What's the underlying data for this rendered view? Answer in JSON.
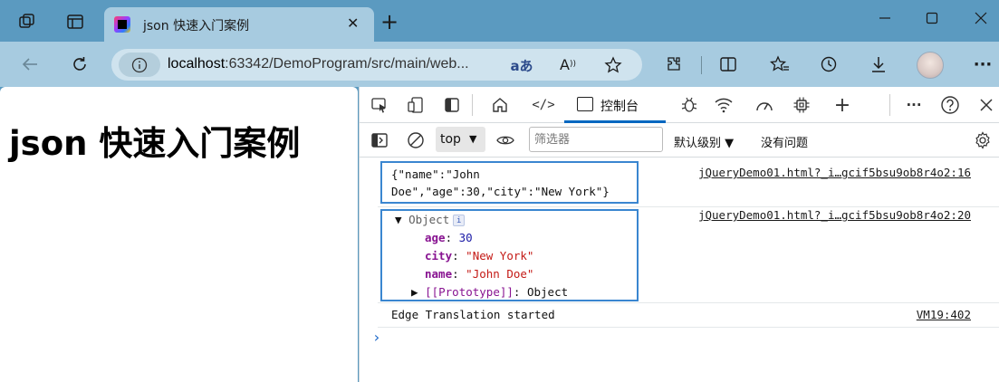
{
  "browser": {
    "tab_title": "json 快速入门案例",
    "tab_close": "✕",
    "new_tab": "+",
    "url_host": "localhost",
    "url_rest": ":63342/DemoProgram/src/main/web...",
    "colors": {
      "frame": "#5b9ac0",
      "toolbar": "#a7cbe0",
      "omnibox": "#cfe3ee"
    },
    "icons": [
      "workspaces-icon",
      "tab-actions-icon",
      "back-icon",
      "refresh-icon",
      "info-icon",
      "translate-icon",
      "read-aloud-icon",
      "favorite-star-icon",
      "extensions-icon",
      "split-screen-icon",
      "favorites-icon",
      "history-icon",
      "downloads-icon",
      "profile-avatar",
      "more-icon"
    ]
  },
  "page": {
    "heading": "json 快速入门案例"
  },
  "devtools": {
    "console_tab": "控制台",
    "context": "top",
    "filter_placeholder": "筛选器",
    "levels": "默认级别 ▼",
    "issues": "没有问题",
    "messages": {
      "first": {
        "line1": "{\"name\":\"John",
        "line2": "Doe\",\"age\":30,\"city\":\"New York\"}",
        "source": "jQueryDemo01.html?_i…gcif5bsu9ob8r4o2:16"
      },
      "second": {
        "object_label": "Object",
        "info": "i",
        "source": "jQueryDemo01.html?_i…gcif5bsu9ob8r4o2:20",
        "props": [
          {
            "key": "age",
            "value": "30"
          },
          {
            "key": "city",
            "value": "\"New York\""
          },
          {
            "key": "name",
            "value": "\"John Doe\""
          }
        ],
        "prototype_key": "[[Prototype]]",
        "prototype_value": "Object"
      },
      "third": {
        "text": "Edge Translation started",
        "source": "VM19:402"
      }
    },
    "prompt": "›"
  }
}
